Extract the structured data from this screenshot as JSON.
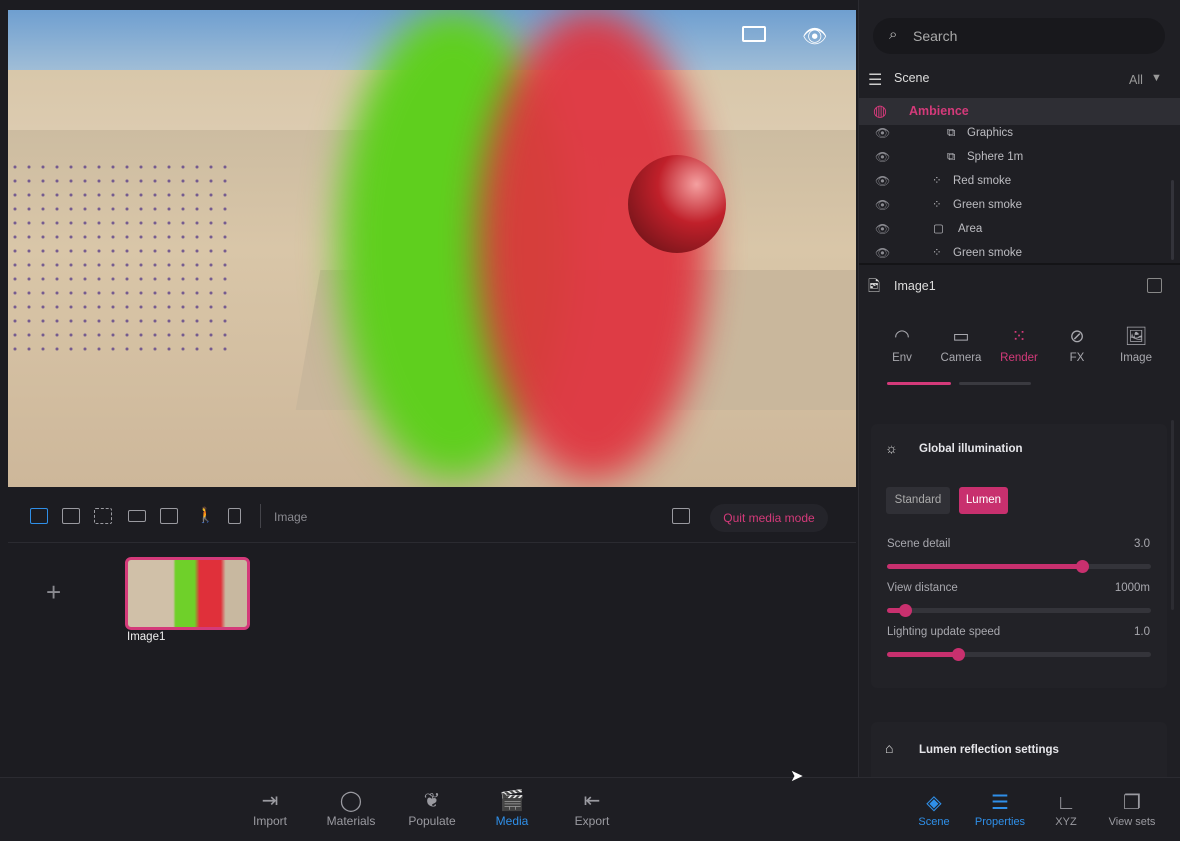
{
  "viewport": {
    "icons": [
      "panel-toggle-icon",
      "eye-icon"
    ]
  },
  "media_toolbar": {
    "section_label": "Image",
    "quit_label": "Quit media mode"
  },
  "media": {
    "add_label": "+",
    "items": [
      {
        "name": "Image1"
      }
    ]
  },
  "bottom_bar": {
    "items": [
      {
        "label": "Import",
        "icon": "import-icon"
      },
      {
        "label": "Materials",
        "icon": "materials-icon"
      },
      {
        "label": "Populate",
        "icon": "populate-icon"
      },
      {
        "label": "Media",
        "icon": "media-icon",
        "active": true
      },
      {
        "label": "Export",
        "icon": "export-icon"
      }
    ],
    "right_items": [
      {
        "label": "Scene",
        "active": true
      },
      {
        "label": "Properties",
        "active": true
      },
      {
        "label": "XYZ"
      },
      {
        "label": "View sets"
      }
    ]
  },
  "right": {
    "search_placeholder": "Search",
    "scene_label": "Scene",
    "filter": "All",
    "tree": [
      {
        "label": "Ambience",
        "selected": true
      },
      {
        "label": "Graphics"
      },
      {
        "label": "Sphere 1m"
      },
      {
        "label": "Red smoke"
      },
      {
        "label": "Green smoke"
      },
      {
        "label": "Area"
      },
      {
        "label": "Green smoke"
      }
    ],
    "object_name": "Image1",
    "tabs": [
      {
        "label": "Env"
      },
      {
        "label": "Camera"
      },
      {
        "label": "Render",
        "active": true
      },
      {
        "label": "FX"
      },
      {
        "label": "Image"
      }
    ],
    "gi": {
      "title": "Global illumination",
      "modes": [
        "Standard",
        "Lumen"
      ],
      "active_mode": "Lumen",
      "sliders": [
        {
          "label": "Scene detail",
          "value": "3.0",
          "fraction": 0.74
        },
        {
          "label": "View distance",
          "value": "1000m",
          "fraction": 0.07
        },
        {
          "label": "Lighting update speed",
          "value": "1.0",
          "fraction": 0.27
        }
      ]
    },
    "lumen_reflection_title": "Lumen reflection settings"
  },
  "colors": {
    "accent": "#c8306e",
    "blue": "#2f8fe8"
  }
}
